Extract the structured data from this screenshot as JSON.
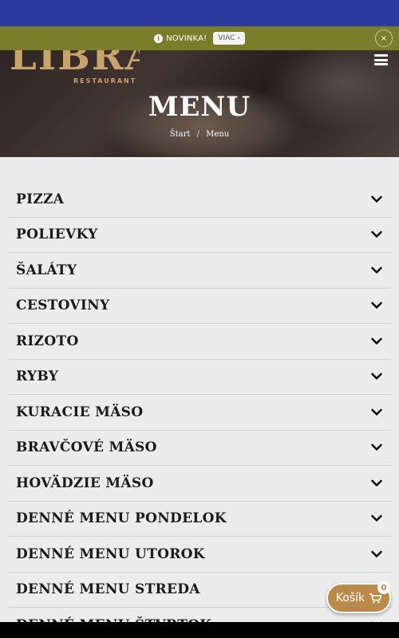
{
  "notice": {
    "text": "NOVINKA!",
    "more_label": "VIAC ›",
    "close_label": "×",
    "info_icon_glyph": "i"
  },
  "header": {
    "logo_text": "LIBRA",
    "logo_sub": "RESTAURANT",
    "title": "MENU",
    "breadcrumb": {
      "home": "Štart",
      "separator": "/",
      "current": "Menu"
    }
  },
  "menu": {
    "items": [
      {
        "label": "PIZZA"
      },
      {
        "label": "POLIEVKY"
      },
      {
        "label": "ŠALÁTY"
      },
      {
        "label": "CESTOVINY"
      },
      {
        "label": "RIZOTO"
      },
      {
        "label": "RYBY"
      },
      {
        "label": "KURACIE MÄSO"
      },
      {
        "label": "BRAVČOVÉ MÄSO"
      },
      {
        "label": "HOVÄDZIE MÄSO"
      },
      {
        "label": "DENNÉ MENU PONDELOK"
      },
      {
        "label": "DENNÉ MENU UTOROK"
      },
      {
        "label": "DENNÉ MENU STREDA"
      },
      {
        "label": "DENNÉ MENU ŠTVRTOK"
      }
    ]
  },
  "cart": {
    "label": "Košík",
    "count": "0",
    "icon": "cart-icon"
  },
  "colors": {
    "topbar": "#2c3a9e",
    "notice_bg": "#7a7d2a",
    "brand_gold": "#c9a46a",
    "cart_bg": "#b98a4a",
    "page_bg": "#ececec"
  }
}
